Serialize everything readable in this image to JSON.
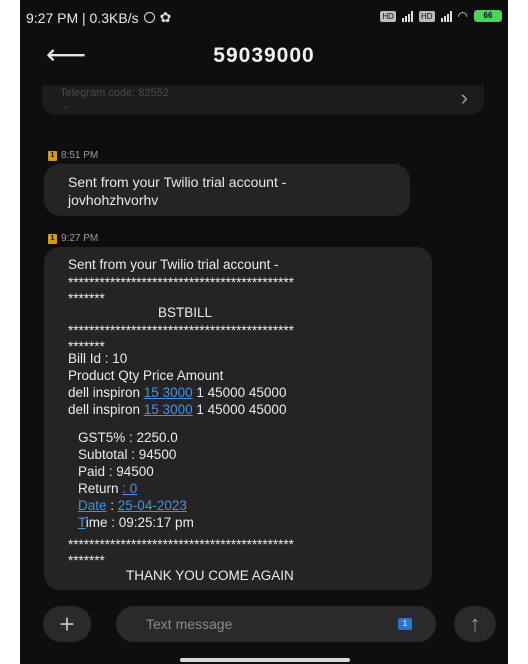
{
  "status": {
    "time_speed": "9:27 PM | 0.3KB/s",
    "battery": "66"
  },
  "header": {
    "title": "59039000"
  },
  "preview": {
    "text": "Telegram code: 82552",
    "more": "..."
  },
  "messages": [
    {
      "sim": "1",
      "time": "8:51 PM",
      "lines": [
        "Sent from your Twilio trial account -",
        "jovhohzhvorhv"
      ]
    },
    {
      "sim": "1",
      "time": "9:27 PM",
      "intro": "Sent from your Twilio trial account -",
      "stars_long": "*******************************************",
      "stars_short": "*******",
      "heading": "BSTBILL",
      "bill_id": "Bill Id : 10",
      "columns": "Product   Qty Price  Amount",
      "item1_pre": "dell inspiron ",
      "item1_link": "15 3000",
      "item1_post": "  1  45000  45000",
      "item2_pre": "dell inspiron ",
      "item2_link": "15 3000",
      "item2_post": "  1  45000  45000",
      "gst": "GST5% : 2250.0",
      "subtotal": "Subtotal : 94500",
      "paid": "Paid : 94500",
      "return_label": "Return ",
      "return_value": ": 0",
      "date_label": "Date",
      "date_value": "25-04-2023",
      "time_first": "T",
      "time_rest": "ime : 09:25:17 pm",
      "footer": "THANK YOU COME AGAIN"
    }
  ],
  "composer": {
    "placeholder": "Text message",
    "sim": "1"
  },
  "icons": {
    "back": "arrow-left-icon",
    "chevron": "chevron-right-icon",
    "add": "plus-icon",
    "send": "arrow-up-icon"
  },
  "colors": {
    "background": "#0e0e0e",
    "bubble": "#242426",
    "link": "#4a90e2",
    "sim_badge": "#d49a1c",
    "battery": "#4ed05e"
  }
}
